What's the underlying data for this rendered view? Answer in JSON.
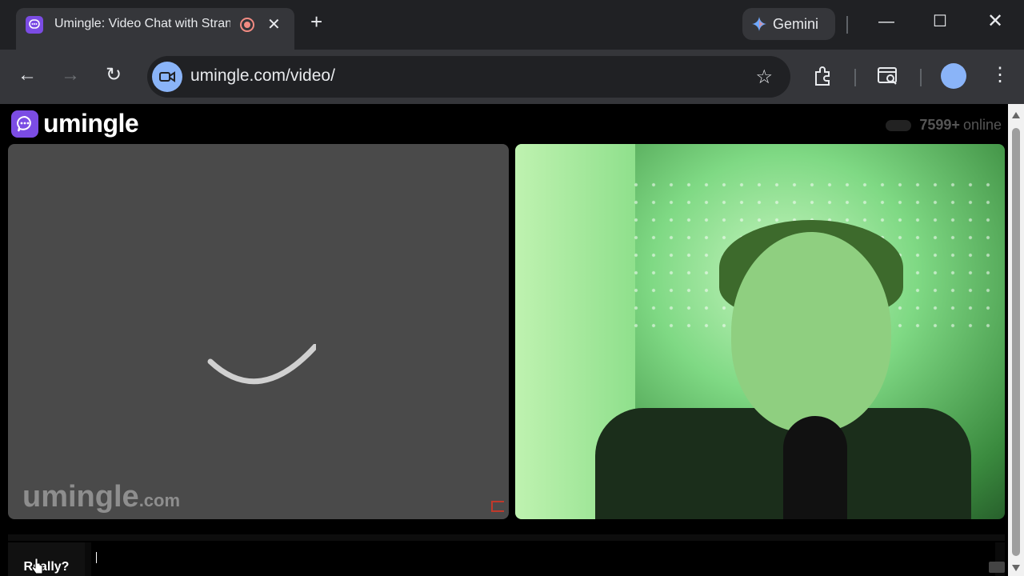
{
  "browser": {
    "tab_title": "Umingle: Video Chat with Strangers",
    "new_tab": "+",
    "gemini_label": "Gemini",
    "url": "umingle.com/video/"
  },
  "site": {
    "logo_text": "umingle",
    "online_count": "7599+",
    "online_label": "online",
    "watermark_main": "umingle",
    "watermark_suffix": ".com"
  },
  "chat": {
    "button_label": "Really?",
    "input_value": ""
  },
  "colors": {
    "brand": "#7b4ce4",
    "video_placeholder": "#4a4a4a",
    "report_flag": "#c0392b"
  },
  "icons": [
    "back-icon",
    "forward-icon",
    "reload-icon",
    "video-camera-icon",
    "star-icon",
    "extensions-icon",
    "tab-search-icon",
    "profile-avatar-icon",
    "more-menu-icon",
    "record-icon",
    "close-icon",
    "gemini-icon",
    "minimize-icon",
    "maximize-icon",
    "window-close-icon",
    "flag-icon",
    "loading-spinner-icon"
  ]
}
